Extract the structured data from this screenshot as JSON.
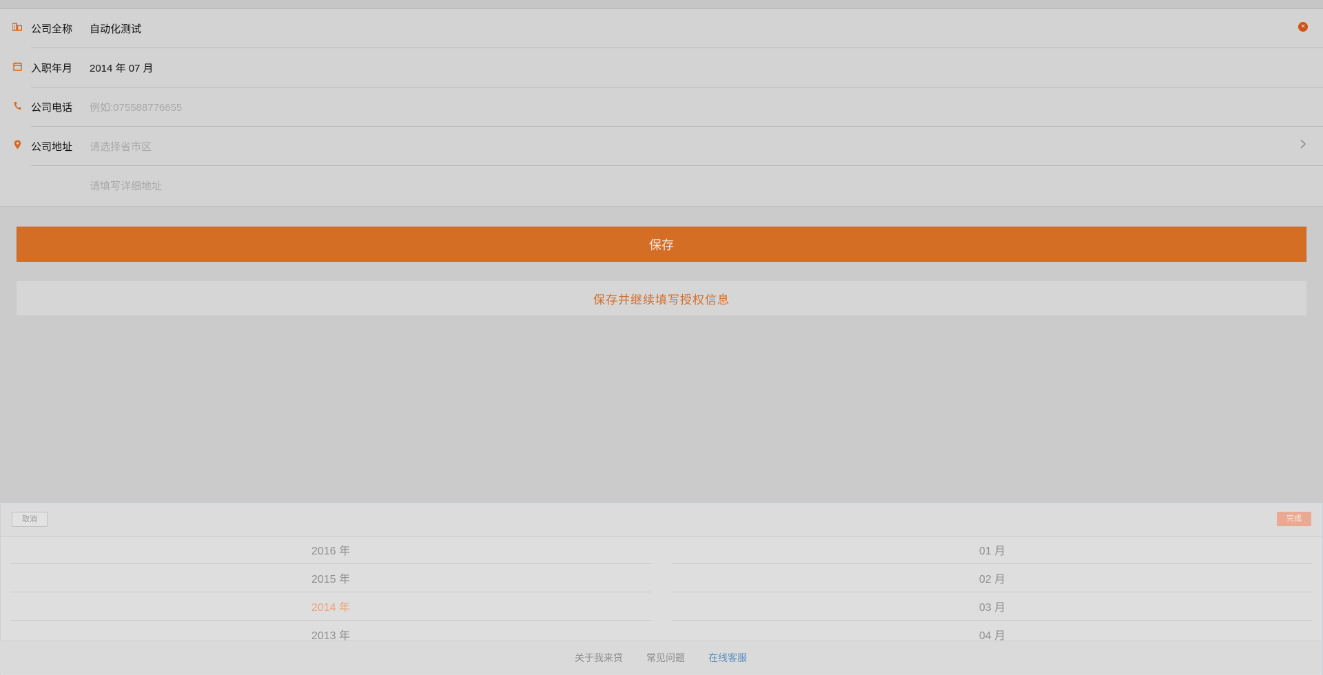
{
  "form": {
    "rows": [
      {
        "label": "公司全称",
        "value": "自动化测试",
        "placeholder": "",
        "icon": "building-icon"
      },
      {
        "label": "入职年月",
        "value": "2014 年 07 月",
        "placeholder": "",
        "icon": "calendar-icon"
      },
      {
        "label": "公司电话",
        "value": "",
        "placeholder": "例如:075588776655",
        "icon": "phone-icon"
      },
      {
        "label": "公司地址",
        "value": "",
        "placeholder": "请选择省市区",
        "icon": "location-pin-icon"
      },
      {
        "label": "",
        "value": "",
        "placeholder": "请填写详细地址",
        "icon": ""
      }
    ],
    "clear_icon": "×"
  },
  "buttons": {
    "save_label": "保存",
    "save_continue_label": "保存并继续填写授权信息"
  },
  "picker": {
    "cancel_label": "取消",
    "done_label": "完成",
    "years": [
      "2016 年",
      "2015 年",
      "2014 年",
      "2013 年"
    ],
    "months": [
      "01 月",
      "02 月",
      "03 月",
      "04 月"
    ],
    "selected_year": "2014 年"
  },
  "footer": {
    "links": [
      "关于我来贷",
      "常见问题",
      "在线客服"
    ]
  },
  "colors": {
    "accent": "#d56e25",
    "link": "#5b8ec0"
  }
}
